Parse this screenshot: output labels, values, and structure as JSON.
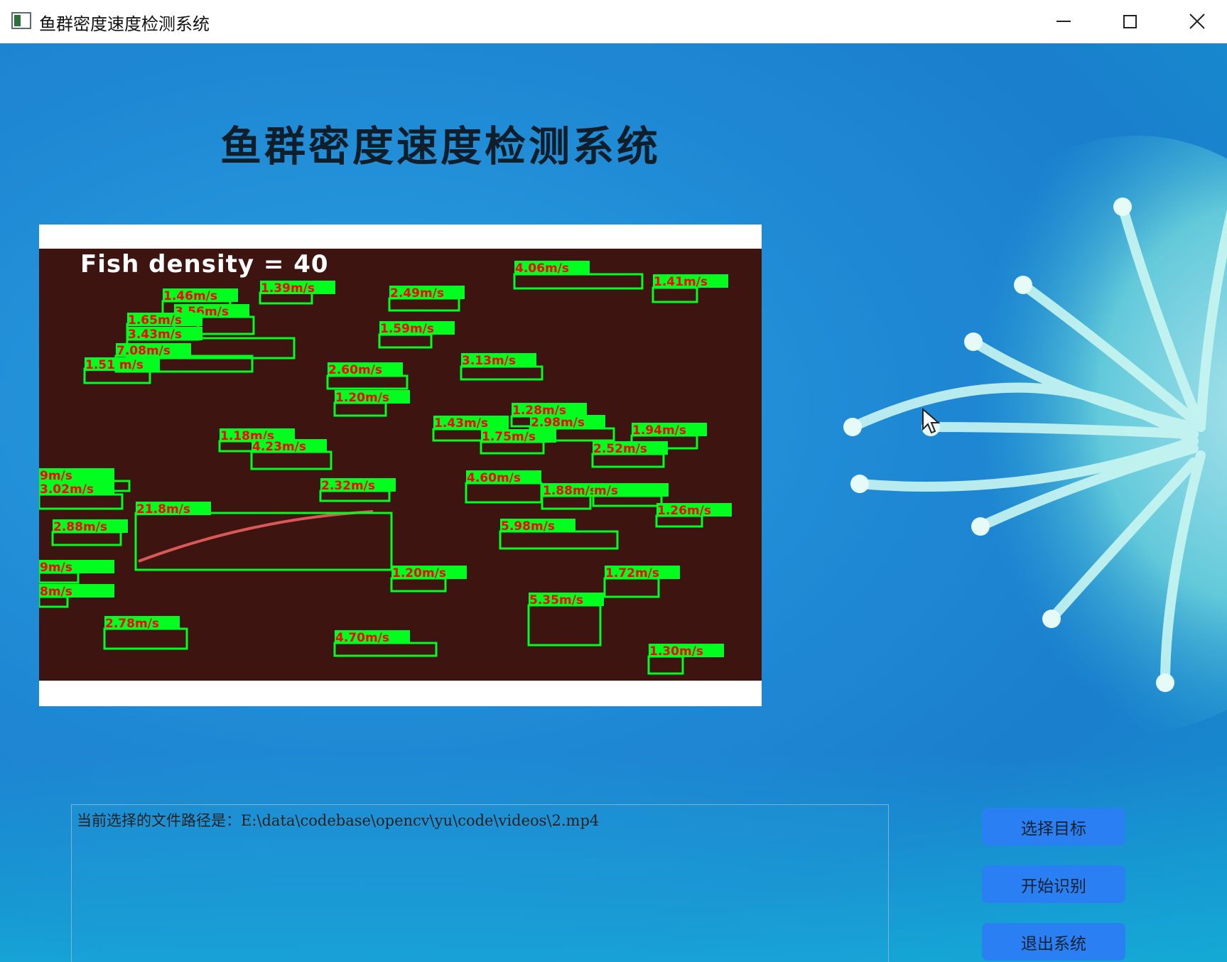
{
  "window": {
    "title": "鱼群密度速度检测系统",
    "controls": {
      "minimize": "minimize-icon",
      "maximize": "maximize-icon",
      "close": "close-icon"
    }
  },
  "main": {
    "title": "鱼群密度速度检测系统"
  },
  "video": {
    "density_label": "Fish density = 40",
    "box_color": "#00ff1e",
    "label_text_color": "#ff0000",
    "detections": [
      "4.06m/s",
      "1.41m/s",
      "1.39m/s",
      "2.49m/s",
      "1.46m/s",
      "3.56m/s",
      "1.65m/s",
      "3.43m/s",
      "1.59m/s",
      "7.08m/s",
      "1.51 m/s",
      "3.13m/s",
      "2.60m/s",
      "1.20m/s",
      "1.28m/s",
      "2.98m/s",
      "1.43m/s",
      "1.75m/s",
      "1.94m/s",
      "1.18m/s",
      "4.23m/s",
      "2.52m/s",
      "9m/s",
      "3.02m/s",
      "2.32m/s",
      "4.60m/s",
      "1.88m/s",
      "m/s",
      "1.26m/s",
      "21.8m/s",
      "2.88m/s",
      "5.98m/s",
      "9m/s",
      "1.20m/s",
      "1.72m/s",
      "8m/s",
      "5.35m/s",
      "2.78m/s",
      "4.70m/s",
      "1.30m/s"
    ]
  },
  "file_path": {
    "text": "当前选择的文件路径是：E:\\data\\codebase\\opencv\\yu\\code\\videos\\2.mp4"
  },
  "buttons": {
    "select_target": "选择目标",
    "start_recognition": "开始识别",
    "exit_system": "退出系统"
  },
  "colors": {
    "button_bg": "#2a7ff3",
    "background": "#1f88d4",
    "video_bg": "#3d140f"
  }
}
